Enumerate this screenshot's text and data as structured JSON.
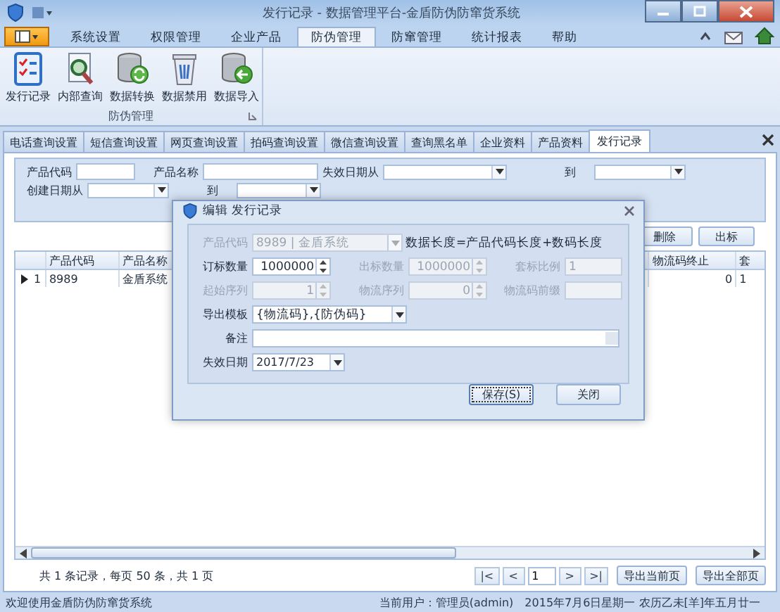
{
  "window": {
    "title": "发行记录 - 数据管理平台-金盾防伪防窜货系统"
  },
  "ribbon": {
    "tabs": [
      {
        "label": "系统设置",
        "selected": false
      },
      {
        "label": "权限管理",
        "selected": false
      },
      {
        "label": "企业产品",
        "selected": false
      },
      {
        "label": "防伪管理",
        "selected": true
      },
      {
        "label": "防窜管理",
        "selected": false
      },
      {
        "label": "统计报表",
        "selected": false
      },
      {
        "label": "帮助",
        "selected": false
      }
    ],
    "group": {
      "label": "防伪管理",
      "buttons": [
        {
          "label": "发行记录",
          "kind": "checklist"
        },
        {
          "label": "内部查询",
          "kind": "search"
        },
        {
          "label": "数据转换",
          "kind": "convert"
        },
        {
          "label": "数据禁用",
          "kind": "trash"
        },
        {
          "label": "数据导入",
          "kind": "import"
        }
      ]
    }
  },
  "doc_tabs": [
    {
      "label": "电话查询设置",
      "selected": false
    },
    {
      "label": "短信查询设置",
      "selected": false
    },
    {
      "label": "网页查询设置",
      "selected": false
    },
    {
      "label": "拍码查询设置",
      "selected": false
    },
    {
      "label": "微信查询设置",
      "selected": false
    },
    {
      "label": "查询黑名单",
      "selected": false
    },
    {
      "label": "企业资料",
      "selected": false
    },
    {
      "label": "产品资料",
      "selected": false
    },
    {
      "label": "发行记录",
      "selected": true
    }
  ],
  "filters": [
    [
      {
        "label": "产品代码",
        "kind": "text"
      },
      {
        "label": "产品名称",
        "kind": "text"
      },
      {
        "label": "失效日期从",
        "kind": "date"
      },
      {
        "label": "到",
        "kind": "date"
      }
    ],
    [
      {
        "label": "创建日期从",
        "kind": "date"
      },
      {
        "label": "到",
        "kind": "date"
      }
    ]
  ],
  "actions": [
    "删除",
    "出标"
  ],
  "grid": {
    "columns": [
      "产品代码",
      "产品名称",
      "物流码终止",
      "套"
    ],
    "rows": [
      {
        "selected": true,
        "number": "1",
        "cells": [
          "8989",
          "金盾系统",
          "0",
          "1"
        ]
      }
    ]
  },
  "pager": {
    "summary": "共 1 条记录，每页 50 条，共 1 页",
    "first": "|<",
    "prev": "<",
    "page": "1",
    "next": ">",
    "last": ">|",
    "buttons": [
      "导出当前页",
      "导出全部页"
    ]
  },
  "status_bar": {
    "welcome": "欢迎使用金盾防伪防窜货系统",
    "user": "当前用户：管理员(admin)",
    "date": "2015年7月6日星期一 农历乙未[羊]年五月廿一"
  },
  "dialog": {
    "title": "编辑 发行记录",
    "rows": [
      [
        {
          "label": "产品代码",
          "kind": "combo",
          "value": "8989 | 金盾系统",
          "disabled": true
        },
        {
          "kind": "note",
          "value": "数据长度=产品代码长度+数码长度"
        }
      ],
      [
        {
          "label": "订标数量",
          "kind": "spin",
          "value": "1000000",
          "disabled": false
        },
        {
          "label": "出标数量",
          "kind": "spin",
          "value": "1000000",
          "disabled": true
        },
        {
          "label": "套标比例",
          "kind": "text",
          "value": "1",
          "disabled": true
        }
      ],
      [
        {
          "label": "起始序列",
          "kind": "spin",
          "value": "1",
          "disabled": true
        },
        {
          "label": "物流序列",
          "kind": "spin",
          "value": "0",
          "disabled": true
        },
        {
          "label": "物流码前缀",
          "kind": "text",
          "disabled": true
        }
      ],
      [
        {
          "label": "导出模板",
          "kind": "combo",
          "value": "{物流码},{防伪码}",
          "disabled": false
        }
      ],
      [
        {
          "label": "备注",
          "kind": "memo",
          "disabled": false
        }
      ],
      [
        {
          "label": "失效日期",
          "kind": "date",
          "value": "2017/7/23",
          "disabled": false
        }
      ]
    ],
    "buttons": [
      "保存(S)",
      "关闭"
    ]
  }
}
